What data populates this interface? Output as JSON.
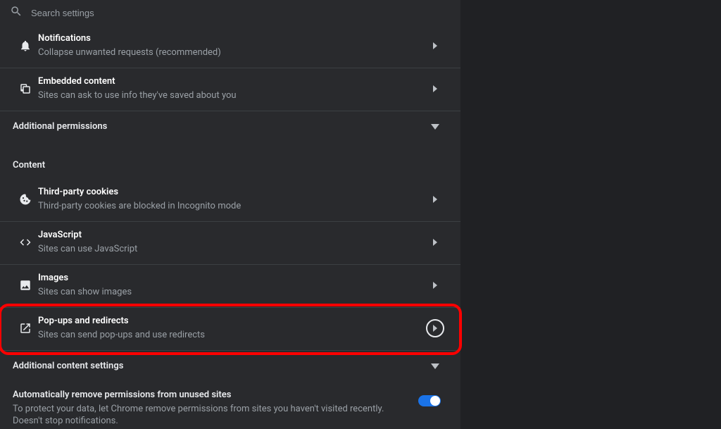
{
  "search": {
    "placeholder": "Search settings"
  },
  "rows": {
    "notifications": {
      "title": "Notifications",
      "sub": "Collapse unwanted requests (recommended)"
    },
    "embedded": {
      "title": "Embedded content",
      "sub": "Sites can ask to use info they've saved about you"
    },
    "additional_permissions": {
      "label": "Additional permissions"
    },
    "content_heading": "Content",
    "cookies": {
      "title": "Third-party cookies",
      "sub": "Third-party cookies are blocked in Incognito mode"
    },
    "javascript": {
      "title": "JavaScript",
      "sub": "Sites can use JavaScript"
    },
    "images": {
      "title": "Images",
      "sub": "Sites can show images"
    },
    "popups": {
      "title": "Pop-ups and redirects",
      "sub": "Sites can send pop-ups and use redirects"
    },
    "additional_content": {
      "label": "Additional content settings"
    },
    "auto_remove": {
      "title": "Automatically remove permissions from unused sites",
      "sub": "To protect your data, let Chrome remove permissions from sites you haven't visited recently. Doesn't stop notifications."
    }
  }
}
